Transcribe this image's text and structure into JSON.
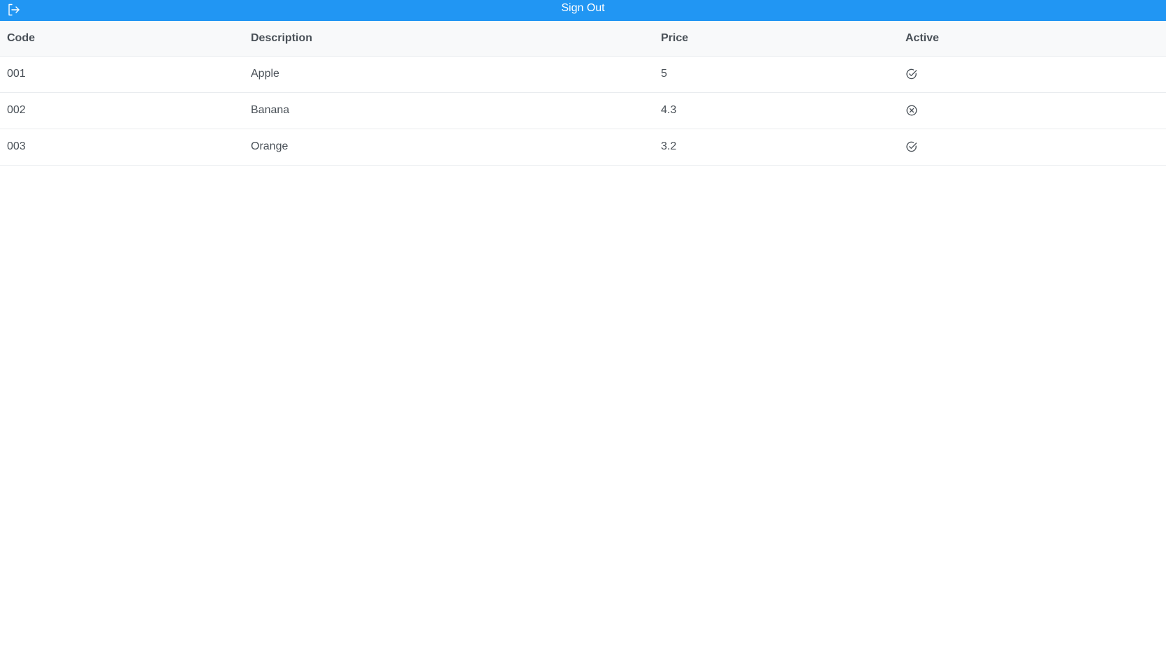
{
  "header": {
    "signout_label": "Sign Out",
    "signout_icon": "sign-out-icon",
    "background_color": "#2196f3"
  },
  "table": {
    "columns": [
      "Code",
      "Description",
      "Price",
      "Active"
    ],
    "rows": [
      {
        "code": "001",
        "description": "Apple",
        "price": "5",
        "active": true,
        "active_icon": "check-circle-icon"
      },
      {
        "code": "002",
        "description": "Banana",
        "price": "4.3",
        "active": false,
        "active_icon": "times-circle-icon"
      },
      {
        "code": "003",
        "description": "Orange",
        "price": "3.2",
        "active": true,
        "active_icon": "check-circle-icon"
      }
    ]
  }
}
